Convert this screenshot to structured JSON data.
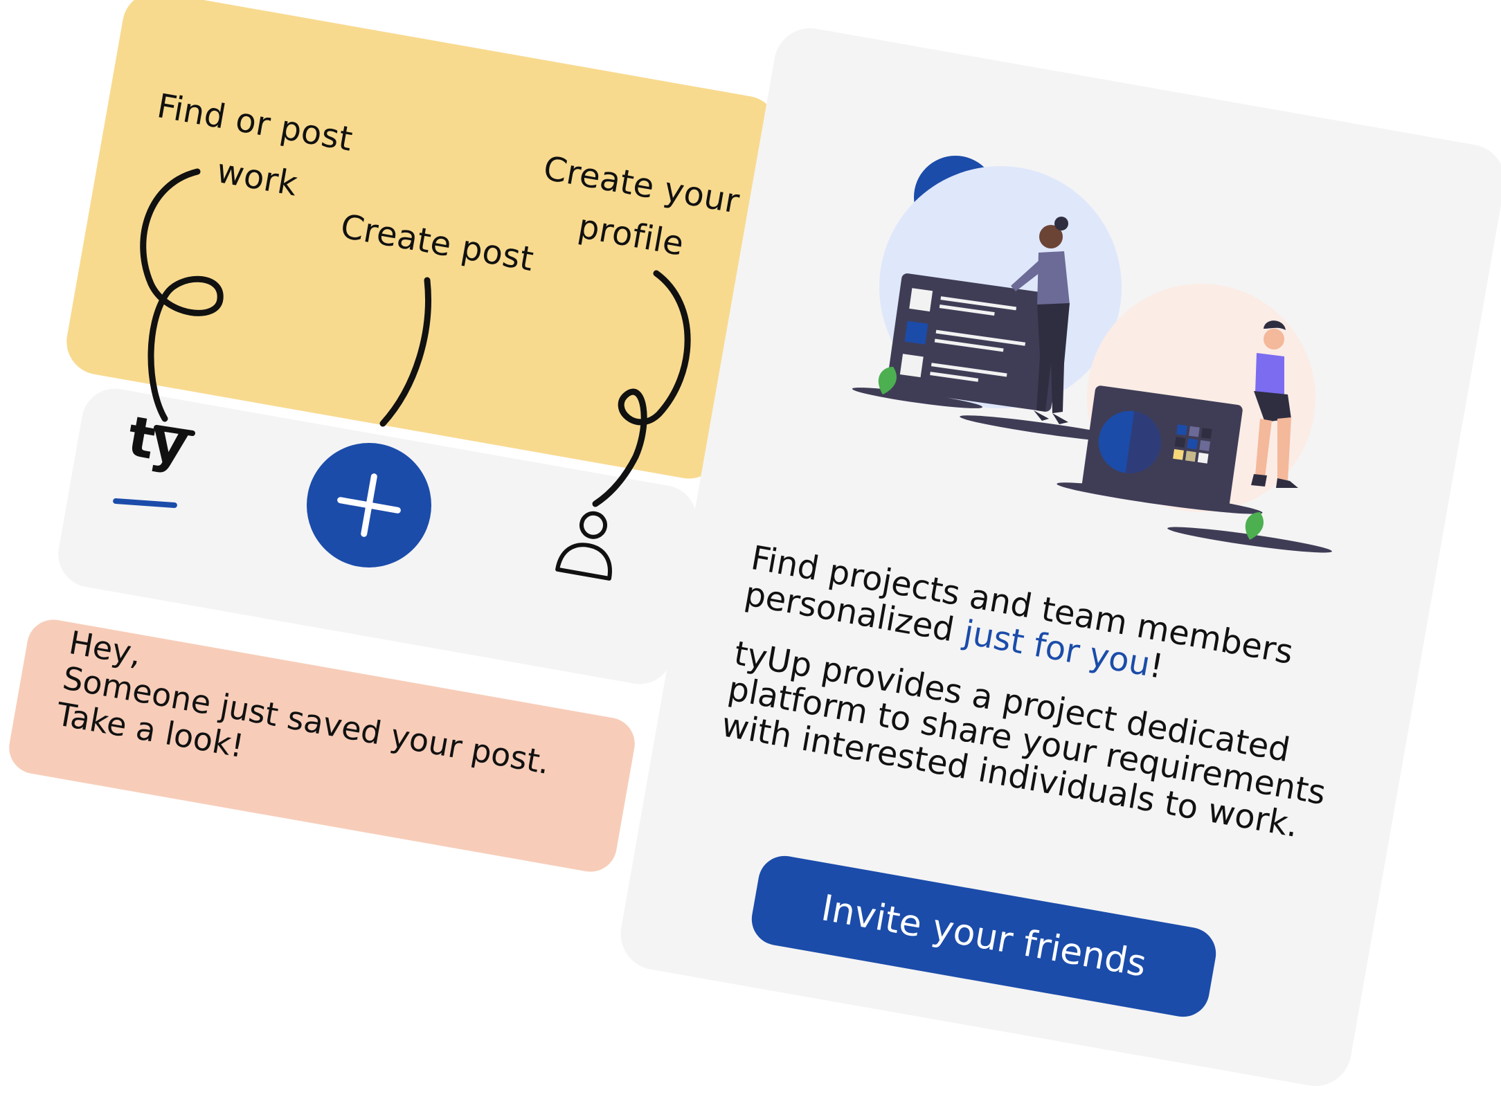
{
  "navigation_card": {
    "callouts": {
      "find_line1": "Find or post",
      "find_line2": "work",
      "create_post": "Create post",
      "profile_line1": "Create your",
      "profile_line2": "profile"
    },
    "logo_text": "ty",
    "icons": [
      "home-logo",
      "plus-icon",
      "user-icon"
    ]
  },
  "notification": {
    "line1": "Hey,",
    "line2": "Someone just saved your post.",
    "line3": "Take a look!"
  },
  "promo": {
    "headline_line1": "Find projects and team members",
    "headline_line2_prefix": "personalized ",
    "headline_highlight": "just for you",
    "headline_suffix": "!",
    "body_line1": "tyUp provides a project dedicated",
    "body_line2": "platform to share your requirements",
    "body_line3": "with interested individuals to work.",
    "button_label": "Invite your friends"
  },
  "colors": {
    "brand_blue": "#1b4caa",
    "yellow": "#f8da8f",
    "pink": "#f7cdb9",
    "card_gray": "#f4f4f4"
  }
}
